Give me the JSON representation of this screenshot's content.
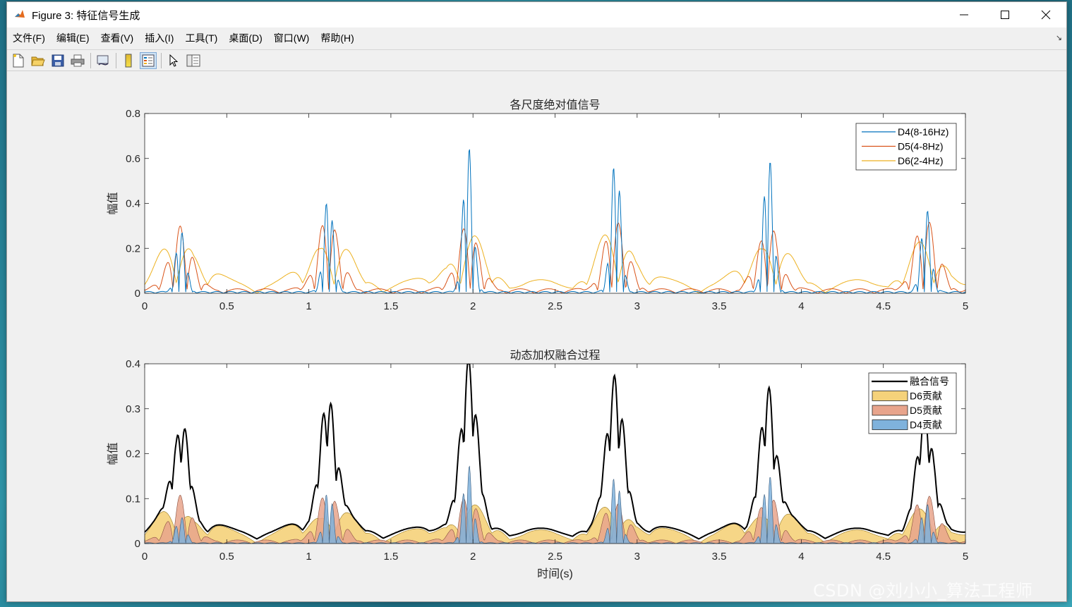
{
  "window": {
    "title": "Figure 3: 特征信号生成",
    "controls": [
      "minimize-icon",
      "maximize-icon",
      "close-icon"
    ]
  },
  "menu": {
    "items": [
      "文件(F)",
      "编辑(E)",
      "查看(V)",
      "插入(I)",
      "工具(T)",
      "桌面(D)",
      "窗口(W)",
      "帮助(H)"
    ],
    "corner": "↘"
  },
  "toolbar": {
    "buttons": [
      "new-figure-icon",
      "open-file-icon",
      "save-icon",
      "print-icon",
      "link-plot-icon",
      "colorbar-icon",
      "legend-icon",
      "pointer-icon",
      "property-editor-icon"
    ]
  },
  "colors": {
    "d4": "#0072BD",
    "d5": "#D95319",
    "d6": "#EDB120",
    "fused": "#000000",
    "d6_fill": "#F5D27A",
    "d5_fill": "#E8A48C",
    "d4_fill": "#7FB2DC"
  },
  "chart_data": [
    {
      "type": "line",
      "title": "各尺度绝对值信号",
      "xlabel": "",
      "ylabel": "幅值",
      "xlim": [
        0,
        5
      ],
      "ylim": [
        0,
        0.8
      ],
      "xticks": [
        "0",
        "0.5",
        "1",
        "1.5",
        "2",
        "2.5",
        "3",
        "3.5",
        "4",
        "4.5",
        "5"
      ],
      "yticks": [
        "0",
        "0.2",
        "0.4",
        "0.6",
        "0.8"
      ],
      "legend_position": "top-right",
      "grid": false,
      "beat_times": [
        0.22,
        1.12,
        1.97,
        2.87,
        3.8,
        4.76
      ],
      "series": [
        {
          "name": "D4(8-16Hz)",
          "peaks": [
            0.28,
            0.44,
            0.67,
            0.62,
            0.63,
            0.38
          ]
        },
        {
          "name": "D5(4-8Hz)",
          "peaks": [
            0.28,
            0.33,
            0.29,
            0.32,
            0.29,
            0.33
          ]
        },
        {
          "name": "D6(2-4Hz)",
          "peaks": [
            0.21,
            0.22,
            0.21,
            0.24,
            0.21,
            0.18
          ]
        }
      ]
    },
    {
      "type": "area",
      "title": "动态加权融合过程",
      "xlabel": "时间(s)",
      "ylabel": "幅值",
      "xlim": [
        0,
        5
      ],
      "ylim": [
        0,
        0.4
      ],
      "xticks": [
        "0",
        "0.5",
        "1",
        "1.5",
        "2",
        "2.5",
        "3",
        "3.5",
        "4",
        "4.5",
        "5"
      ],
      "yticks": [
        "0",
        "0.1",
        "0.2",
        "0.3",
        "0.4"
      ],
      "legend_position": "top-right",
      "grid": false,
      "beat_times": [
        0.22,
        1.12,
        1.97,
        2.87,
        3.8,
        4.76
      ],
      "series": [
        {
          "name": "融合信号",
          "peaks": [
            0.23,
            0.29,
            0.35,
            0.33,
            0.3,
            0.24
          ]
        },
        {
          "name": "D6贡献",
          "peaks": [
            0.06,
            0.06,
            0.06,
            0.06,
            0.06,
            0.05
          ]
        },
        {
          "name": "D5贡献",
          "peaks": [
            0.1,
            0.11,
            0.1,
            0.09,
            0.1,
            0.11
          ]
        },
        {
          "name": "D4贡献",
          "peaks": [
            0.06,
            0.12,
            0.18,
            0.16,
            0.16,
            0.09
          ]
        }
      ]
    }
  ],
  "watermark": "CSDN @刘小小_算法工程师"
}
